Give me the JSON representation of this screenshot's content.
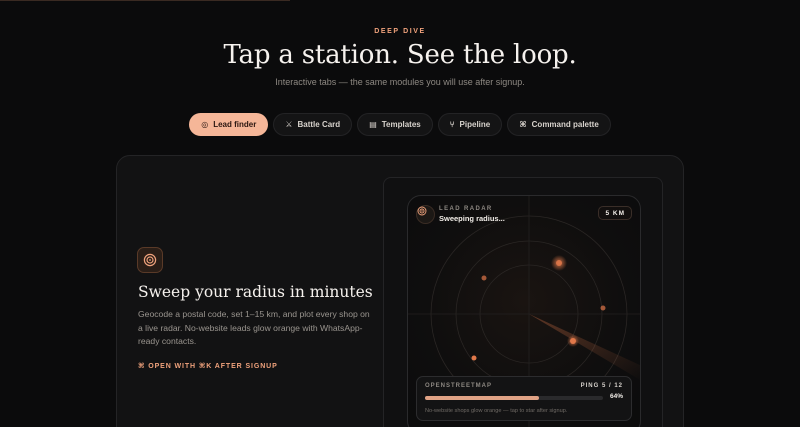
{
  "header": {
    "eyebrow": "DEEP DIVE",
    "title": "Tap a station. See the loop.",
    "subtitle": "Interactive tabs — the same modules you will use after signup."
  },
  "tabs": [
    {
      "label": "Lead finder",
      "icon": "radar-icon",
      "active": true
    },
    {
      "label": "Battle Card",
      "icon": "swords-icon",
      "active": false
    },
    {
      "label": "Templates",
      "icon": "template-icon",
      "active": false
    },
    {
      "label": "Pipeline",
      "icon": "branch-icon",
      "active": false
    },
    {
      "label": "Command palette",
      "icon": "command-icon",
      "active": false
    }
  ],
  "feature": {
    "icon": "radar-icon",
    "title": "Sweep your radius in minutes",
    "description": "Geocode a postal code, set 1–15 km, and plot every shop on a live radar. No-website leads glow orange with WhatsApp-ready contacts.",
    "cta": "⌘ OPEN WITH ⌘K AFTER SIGNUP"
  },
  "radar": {
    "label": "LEAD RADAR",
    "status": "Sweeping radius...",
    "radius_badge": "5 KM",
    "source": "OPENSTREETMAP",
    "ping": "PING 5 / 12",
    "progress_percent": 64,
    "progress_label": "64%",
    "note": "No-website shops glow orange — tap to star after signup."
  },
  "colors": {
    "accent": "#f0a27c",
    "active_tab": "#f5b698",
    "background": "#0b0b0c",
    "lead_glow": "#e0784a"
  }
}
